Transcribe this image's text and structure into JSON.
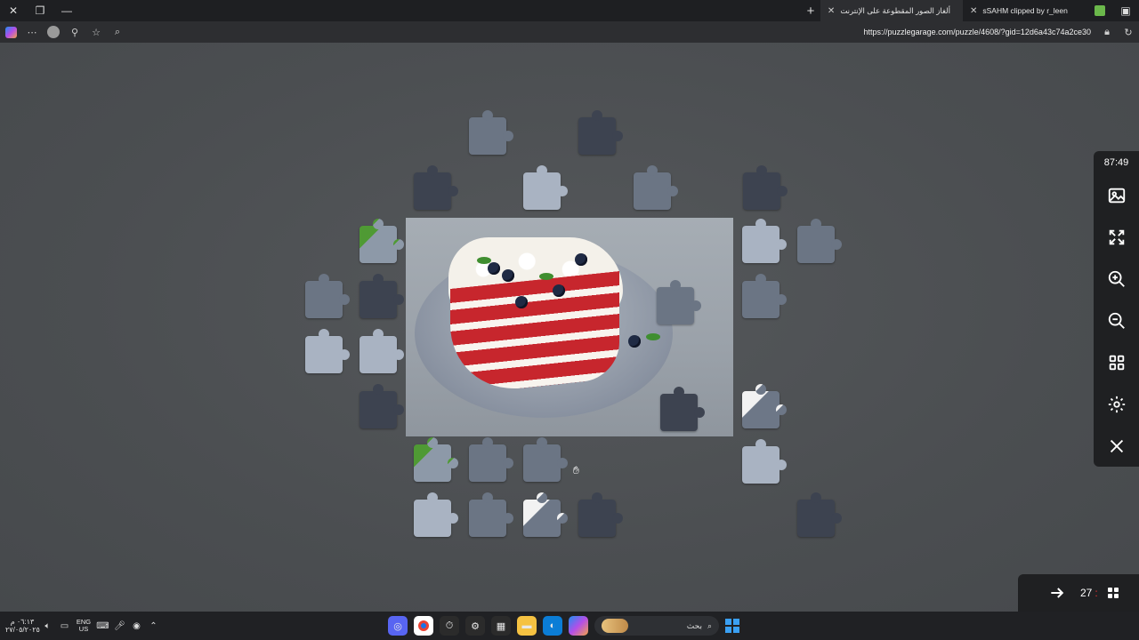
{
  "browser": {
    "tabs": [
      {
        "title": "ألغاز الصور المقطوعة على الإنترنت",
        "active": true
      },
      {
        "title": "sSAHM clipped by r_leen",
        "active": false
      }
    ],
    "url": "https://puzzlegarage.com/puzzle/4608/?gid=12d6a43c74a2ce30",
    "icons": {
      "close": "close-icon",
      "restore": "restore-icon",
      "minimize": "minimize-icon",
      "new_tab": "plus-icon",
      "more": "ellipsis-icon",
      "profile": "profile-icon",
      "extensions": "puzzle-icon",
      "favorites": "star-icon",
      "search": "search-icon",
      "lock": "lock-icon",
      "refresh": "refresh-icon"
    }
  },
  "game": {
    "timer": "87:49",
    "pieces_count": "27",
    "pieces_separator": ":",
    "tools": [
      {
        "name": "preview-image",
        "icon": "image-icon"
      },
      {
        "name": "fullscreen",
        "icon": "expand-icon"
      },
      {
        "name": "zoom-in",
        "icon": "zoom-in-icon"
      },
      {
        "name": "zoom-out",
        "icon": "zoom-out-icon"
      },
      {
        "name": "arrange-pieces",
        "icon": "grid-icon"
      },
      {
        "name": "settings",
        "icon": "gear-icon"
      },
      {
        "name": "close",
        "icon": "close-icon"
      }
    ]
  },
  "taskbar": {
    "clock_time": "٠٦:١٣ م",
    "clock_date": "٢٧/٠٥/٢٠٢٥",
    "lang_top": "ENG",
    "lang_bottom": "US",
    "search_label": "بحث",
    "icons": [
      "chevron-up-icon",
      "wifi-icon",
      "microphone-icon",
      "keyboard-icon",
      "sound-icon",
      "display-icon"
    ]
  },
  "colors": {
    "workspace_bg": "#4b4e51",
    "panel_bg": "#1f2022",
    "board_bg": "#9aa1a9",
    "cake_red": "#c7262d"
  }
}
